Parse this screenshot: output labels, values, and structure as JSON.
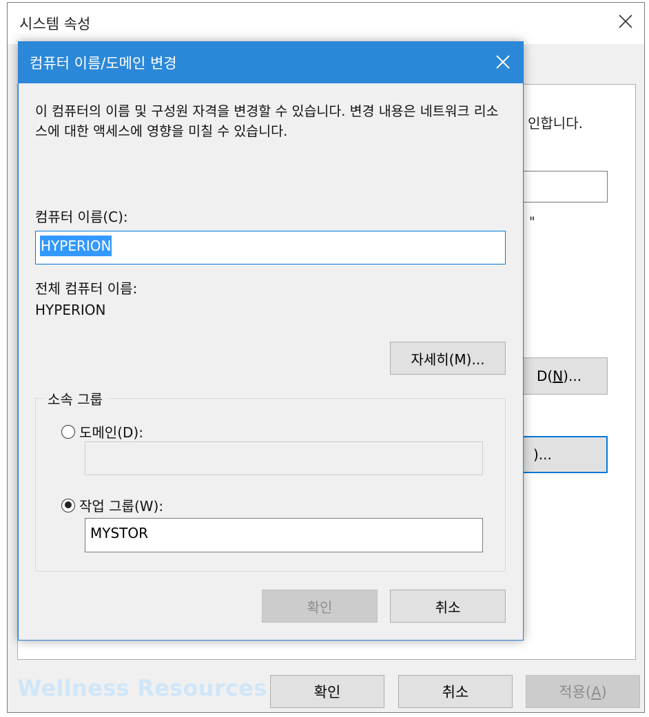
{
  "system_properties": {
    "title": "시스템 속성",
    "desc_tail": "인합니다.",
    "quote_tail": "\"",
    "network_btn_label": "D(N)...",
    "change_btn_label": ")...",
    "ok_label": "확인",
    "cancel_label": "취소",
    "apply_label": "적용(A)"
  },
  "watermark": "Wellness Resources",
  "dialog": {
    "title": "컴퓨터 이름/도메인 변경",
    "description": "이 컴퓨터의 이름 및 구성원 자격을 변경할 수 있습니다. 변경 내용은 네트워크 리소스에 대한 액세스에 영향을 미칠 수 있습니다.",
    "computer_name_label": "컴퓨터 이름(C):",
    "computer_name_value": "HYPERION",
    "full_name_label": "전체 컴퓨터 이름:",
    "full_name_value": "HYPERION",
    "details_btn_label": "자세히(M)...",
    "member_of_label": "소속 그룹",
    "domain_label": "도메인(D):",
    "domain_value": "",
    "domain_selected": false,
    "workgroup_label": "작업 그룹(W):",
    "workgroup_value": "MYSTOR",
    "workgroup_selected": true,
    "ok_label": "확인",
    "cancel_label": "취소"
  },
  "colors": {
    "title_bar": "#2b88d8",
    "selection": "#3399ff",
    "focus_border": "#0078d7",
    "watermark": "#cfe6f9"
  }
}
